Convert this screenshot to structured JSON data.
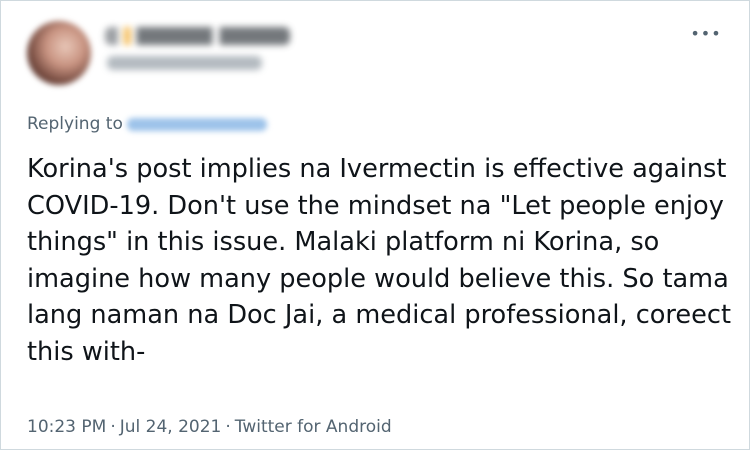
{
  "tweet": {
    "more_icon": "more-horizontal-icon",
    "more_glyph": "•••",
    "replying_to_label": "Replying to",
    "text_lines": [
      "Korina's post implies na Ivermectin is effective against",
      "COVID-19. Don't use the mindset na \"Let people enjoy",
      "things\" in this issue. Malaki platform ni Korina, so",
      "imagine how many people would believe this. So tama",
      "lang naman na Doc Jai, a medical professional, coreect",
      "this with-"
    ],
    "time": "10:23 PM",
    "separator": "·",
    "date": "Jul 24, 2021",
    "source": "Twitter for Android"
  },
  "colors": {
    "text": "#0f1419",
    "secondary": "#536471",
    "border": "#cfd9de",
    "link_blur": "#9dc3ea"
  }
}
